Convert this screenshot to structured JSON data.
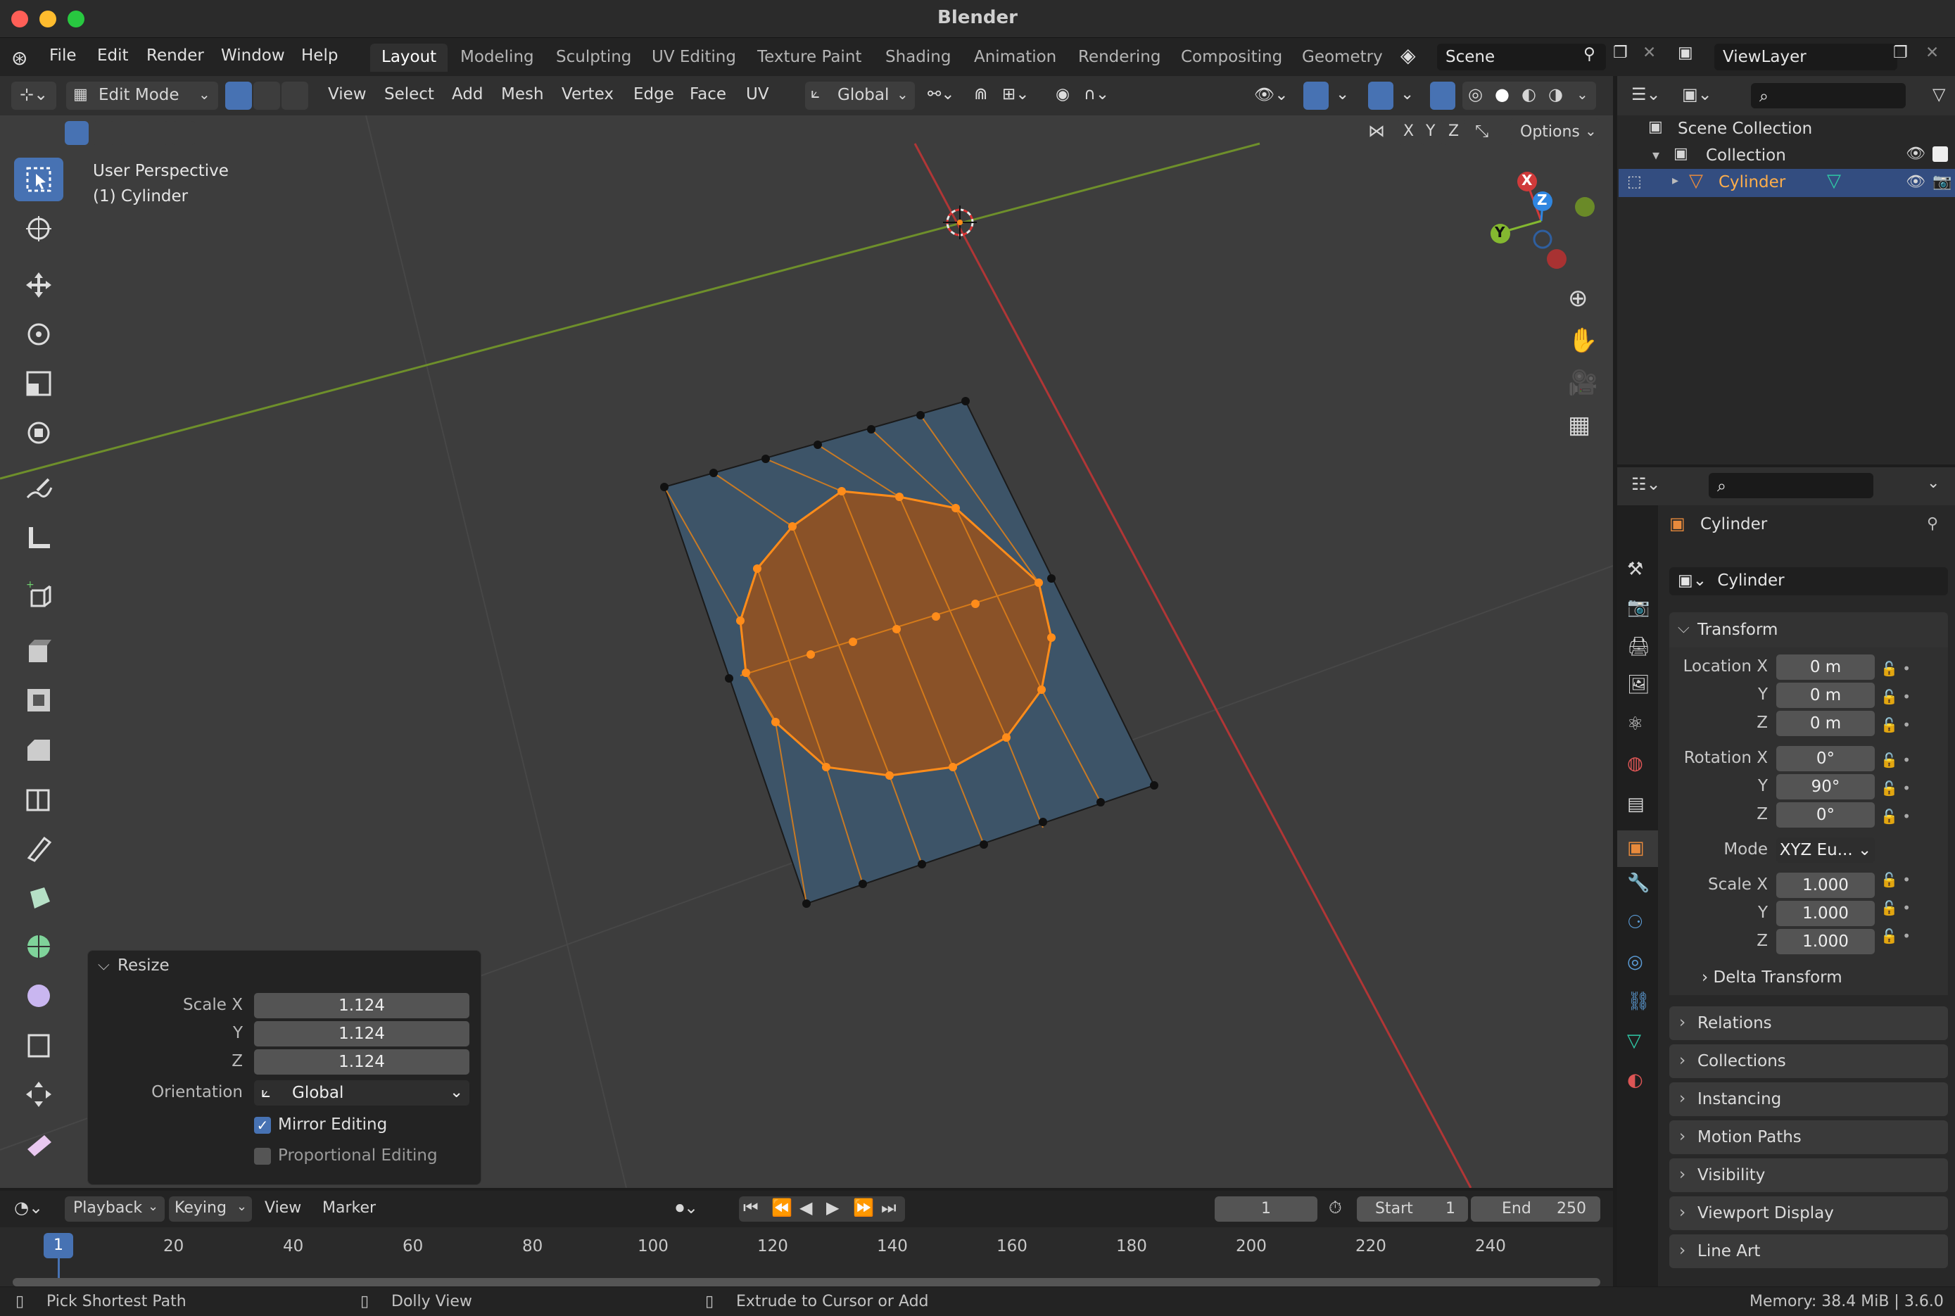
{
  "window": {
    "title": "Blender"
  },
  "menus": [
    "File",
    "Edit",
    "Render",
    "Window",
    "Help"
  ],
  "workspaces": [
    "Layout",
    "Modeling",
    "Sculpting",
    "UV Editing",
    "Texture Paint",
    "Shading",
    "Animation",
    "Rendering",
    "Compositing",
    "Geometry"
  ],
  "scene": {
    "name": "Scene",
    "view_layer": "ViewLayer"
  },
  "viewport_header": {
    "mode": "Edit Mode",
    "menus": [
      "View",
      "Select",
      "Add",
      "Mesh",
      "Vertex",
      "Edge",
      "Face",
      "UV"
    ],
    "orientation": "Global",
    "axes": [
      "X",
      "Y",
      "Z"
    ],
    "options": "Options"
  },
  "viewport": {
    "view_name": "User Perspective",
    "object_info": "(1) Cylinder",
    "gizmo_axes": [
      "X",
      "Y",
      "Z"
    ]
  },
  "resize_panel": {
    "title": "Resize",
    "scale_x_label": "Scale X",
    "y_label": "Y",
    "z_label": "Z",
    "scale_x": "1.124",
    "scale_y": "1.124",
    "scale_z": "1.124",
    "orientation_label": "Orientation",
    "orientation": "Global",
    "mirror_editing": "Mirror Editing",
    "mirror_checked": true,
    "proportional_editing": "Proportional Editing",
    "proportional_checked": false
  },
  "outliner": {
    "scene_collection": "Scene Collection",
    "collection": "Collection",
    "object": "Cylinder"
  },
  "properties": {
    "object_name": "Cylinder",
    "object_field": "Cylinder",
    "transform_title": "Transform",
    "location_label": "Location X",
    "rotation_label": "Rotation X",
    "scale_label": "Scale X",
    "y": "Y",
    "z": "Z",
    "mode_label": "Mode",
    "location": [
      "0 m",
      "0 m",
      "0 m"
    ],
    "rotation": [
      "0°",
      "90°",
      "0°"
    ],
    "mode": "XYZ Eu...",
    "scale": [
      "1.000",
      "1.000",
      "1.000"
    ],
    "subpanels": [
      "Delta Transform",
      "Relations",
      "Collections",
      "Instancing",
      "Motion Paths",
      "Visibility",
      "Viewport Display",
      "Line Art"
    ]
  },
  "timeline": {
    "menus": [
      "Playback",
      "Keying",
      "View",
      "Marker"
    ],
    "current_frame": "1",
    "start_label": "Start",
    "start": "1",
    "end_label": "End",
    "end": "250",
    "frame_marks": [
      "20",
      "40",
      "60",
      "80",
      "100",
      "120",
      "140",
      "160",
      "180",
      "200",
      "220",
      "240"
    ],
    "playhead": "1"
  },
  "statusbar": {
    "left": "Pick Shortest Path",
    "middle": "Dolly View",
    "right": "Extrude to Cursor or Add",
    "info": "Memory: 38.4 MiB | 3.6.0"
  },
  "colors": {
    "accent": "#4772b3",
    "selection": "#ff8c1a",
    "x_axis": "#d03a3a",
    "y_axis": "#84b830",
    "z_axis": "#2f86e0"
  }
}
